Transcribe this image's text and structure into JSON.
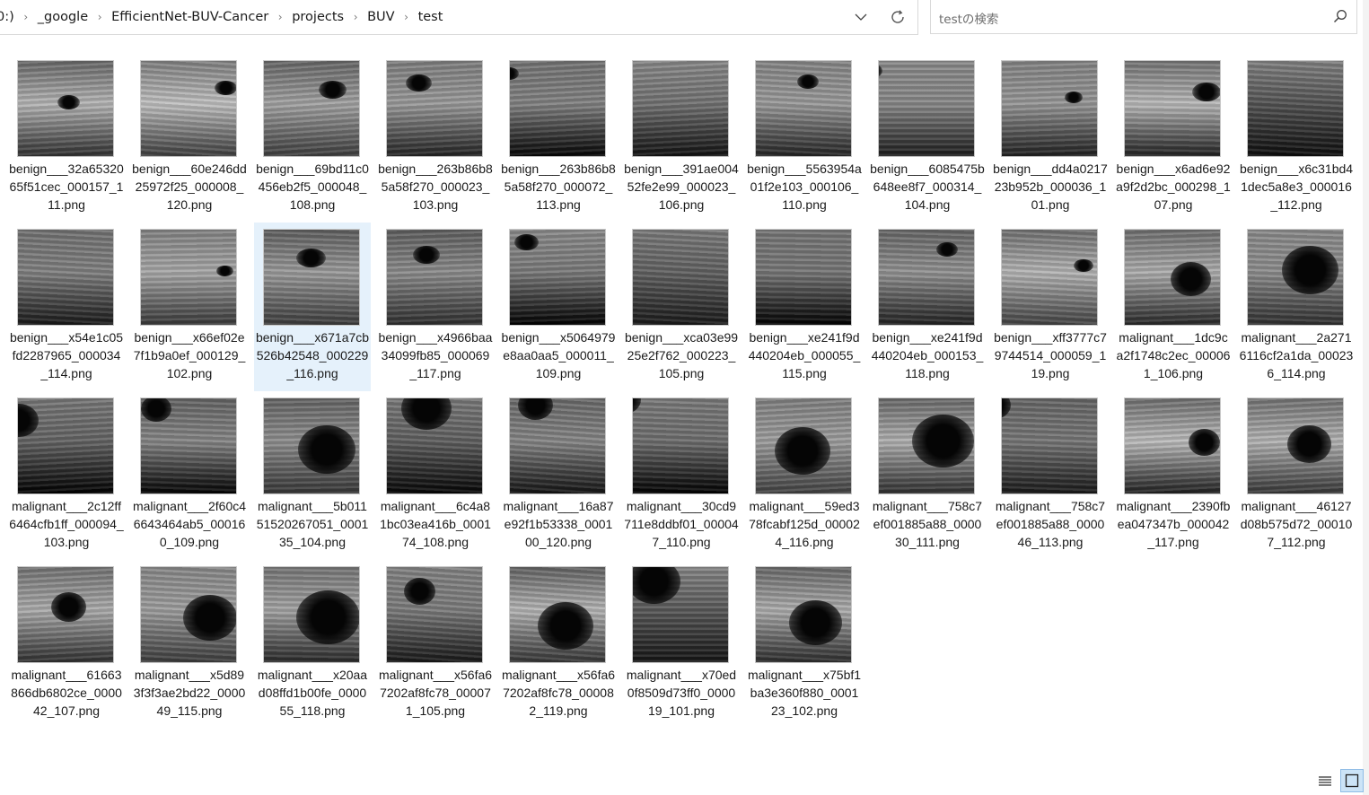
{
  "breadcrumb": [
    "0:)",
    "_google",
    "EfficientNet-BUV-Cancer",
    "projects",
    "BUV",
    "test"
  ],
  "search": {
    "placeholder": "testの検索"
  },
  "colors": {
    "selection": "#e5f1fb",
    "thumb_border": "#c8c8c8",
    "accent": "#0078d7"
  },
  "icons": {
    "addr_dropdown": "chevron-down-icon",
    "refresh": "refresh-icon",
    "search": "search-icon",
    "details_view": "details-view-icon",
    "large_icons_view": "large-icons-view-icon"
  },
  "selected_index": 13,
  "files": [
    "benign___32a6532065f51cec_000157_111.png",
    "benign___60e246dd25972f25_000008_120.png",
    "benign___69bd11c0456eb2f5_000048_108.png",
    "benign___263b86b85a58f270_000023_103.png",
    "benign___263b86b85a58f270_000072_113.png",
    "benign___391ae00452fe2e99_000023_106.png",
    "benign___5563954a01f2e103_000106_110.png",
    "benign___6085475b648ee8f7_000314_104.png",
    "benign___dd4a021723b952b_000036_101.png",
    "benign___x6ad6e92a9f2d2bc_000298_107.png",
    "benign___x6c31bd41dec5a8e3_000016_112.png",
    "benign___x54e1c05fd2287965_000034_114.png",
    "benign___x66ef02e7f1b9a0ef_000129_102.png",
    "benign___x671a7cb526b42548_000229_116.png",
    "benign___x4966baa34099fb85_000069_117.png",
    "benign___x5064979e8aa0aa5_000011_109.png",
    "benign___xca03e9925e2f762_000223_105.png",
    "benign___xe241f9d440204eb_000055_115.png",
    "benign___xe241f9d440204eb_000153_118.png",
    "benign___xff3777c79744514_000059_119.png",
    "malignant___1dc9ca2f1748c2ec_000061_106.png",
    "malignant___2a2716116cf2a1da_000236_114.png",
    "malignant___2c12ff6464cfb1ff_000094_103.png",
    "malignant___2f60c46643464ab5_000160_109.png",
    "malignant___5b01151520267051_000135_104.png",
    "malignant___6c4a81bc03ea416b_000174_108.png",
    "malignant___16a87e92f1b53338_000100_120.png",
    "malignant___30cd9711e8ddbf01_000047_110.png",
    "malignant___59ed378fcabf125d_000024_116.png",
    "malignant___758c7ef001885a88_000030_111.png",
    "malignant___758c7ef001885a88_000046_113.png",
    "malignant___2390fbea047347b_000042_117.png",
    "malignant___46127d08b575d72_000107_112.png",
    "malignant___61663866db6802ce_000042_107.png",
    "malignant___x5d893f3f3ae2bd22_000049_115.png",
    "malignant___x20aad08ffd1b00fe_000055_118.png",
    "malignant___x56fa67202af8fc78_000071_105.png",
    "malignant___x56fa67202af8fc78_000082_119.png",
    "malignant___x70ed0f8509d73ff0_000019_101.png",
    "malignant___x75bf1ba3e360f880_000123_102.png"
  ]
}
